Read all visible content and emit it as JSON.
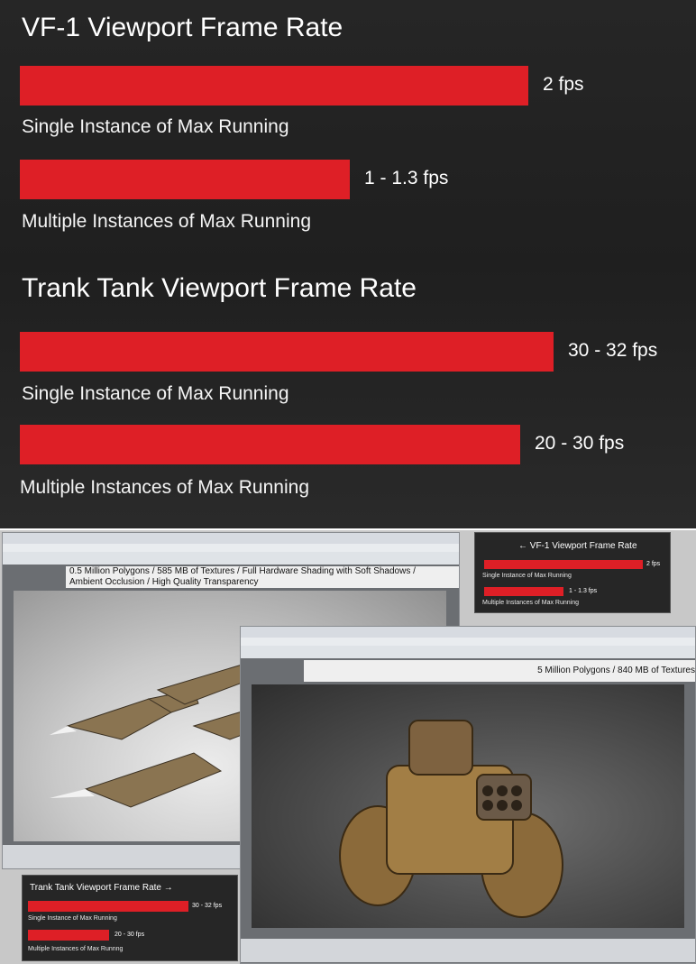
{
  "colors": {
    "bar": "#de1f26",
    "panel_background": "#222222",
    "text": "#ffffff"
  },
  "chart_data": [
    {
      "type": "bar",
      "orientation": "horizontal",
      "title": "VF-1 Viewport Frame Rate",
      "unit": "fps",
      "categories": [
        "Single Instance of Max Running",
        "Multiple Instances of Max Running"
      ],
      "values": [
        2,
        1.3
      ],
      "value_ranges": [
        [
          2,
          2
        ],
        [
          1,
          1.3
        ]
      ],
      "value_labels": [
        "2 fps",
        "1 - 1.3 fps"
      ],
      "xlim": [
        0,
        2.1
      ]
    },
    {
      "type": "bar",
      "orientation": "horizontal",
      "title": "Trank Tank Viewport Frame Rate",
      "unit": "fps",
      "categories": [
        "Single Instance of Max Running",
        "Multiple Instances of Max Running"
      ],
      "values": [
        32,
        30
      ],
      "value_ranges": [
        [
          30,
          32
        ],
        [
          20,
          30
        ]
      ],
      "value_labels": [
        "30 - 32 fps",
        "20 - 30 fps"
      ],
      "xlim": [
        0,
        32
      ]
    }
  ],
  "screenshot": {
    "window1_caption_line1": "0.5 Million Polygons / 585 MB of Textures / Full Hardware Shading with Soft Shadows /",
    "window1_caption_line2": "Ambient Occlusion / High Quality Transparency",
    "window2_caption": "5 Million Polygons / 840 MB of Textures",
    "inset_vf1": {
      "title": "← VF-1 Viewport Frame Rate",
      "label1": "Single Instance of Max Running",
      "value1": "2 fps",
      "label2": "Multiple Instances of Max Running",
      "value2": "1 - 1.3 fps"
    },
    "inset_tank": {
      "title": "Trank Tank Viewport Frame Rate →",
      "label1": "Single Instance of Max Running",
      "value1": "30 - 32 fps",
      "label2": "Multiple Instances of Max Runnng",
      "value2": "20 - 30 fps"
    }
  }
}
